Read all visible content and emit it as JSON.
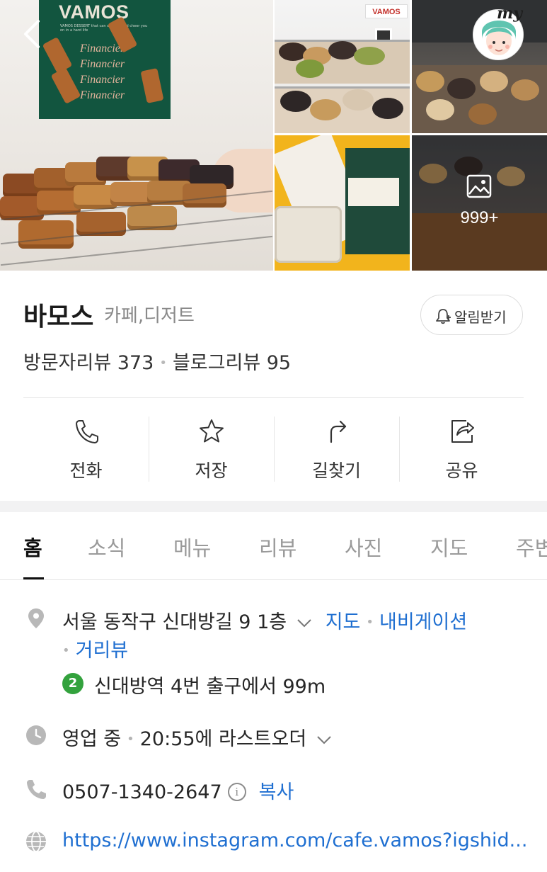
{
  "photos": {
    "poster_title": "VAMOS",
    "poster_subtitle": "VAMOS DESSERT that can comfort and cheer you on in a hard life",
    "poster_words": [
      "Financier",
      "Financier",
      "Financier",
      "Financier"
    ],
    "store_sign": "VAMOS",
    "more_count": "999+",
    "profile_badge": "my"
  },
  "place": {
    "name": "바모스",
    "category": "카페,디저트",
    "alert_label": "알림받기",
    "visitor_reviews": "방문자리뷰 373",
    "blog_reviews": "블로그리뷰 95"
  },
  "actions": [
    {
      "label": "전화",
      "icon": "phone-icon"
    },
    {
      "label": "저장",
      "icon": "star-icon"
    },
    {
      "label": "길찾기",
      "icon": "directions-icon"
    },
    {
      "label": "공유",
      "icon": "share-icon"
    }
  ],
  "tabs": [
    "홈",
    "소식",
    "메뉴",
    "리뷰",
    "사진",
    "지도",
    "주변"
  ],
  "info": {
    "address": "서울 동작구 신대방길 9 1층",
    "map_link": "지도",
    "navigation_link": "내비게이션",
    "street_view_link": "거리뷰",
    "subway_line": "2",
    "subway_text": "신대방역 4번 출구에서 99m",
    "hours_status": "영업 중",
    "hours_detail": "20:55에 라스트오더",
    "phone": "0507-1340-2647",
    "phone_info_mark": "i",
    "copy_label": "복사",
    "website": "https://www.instagram.com/cafe.vamos?igshid..."
  },
  "colors": {
    "link": "#1f6fd1",
    "subway_line_2": "#33a23d",
    "poster_green": "#12553f",
    "divider": "#e7e7e7"
  }
}
